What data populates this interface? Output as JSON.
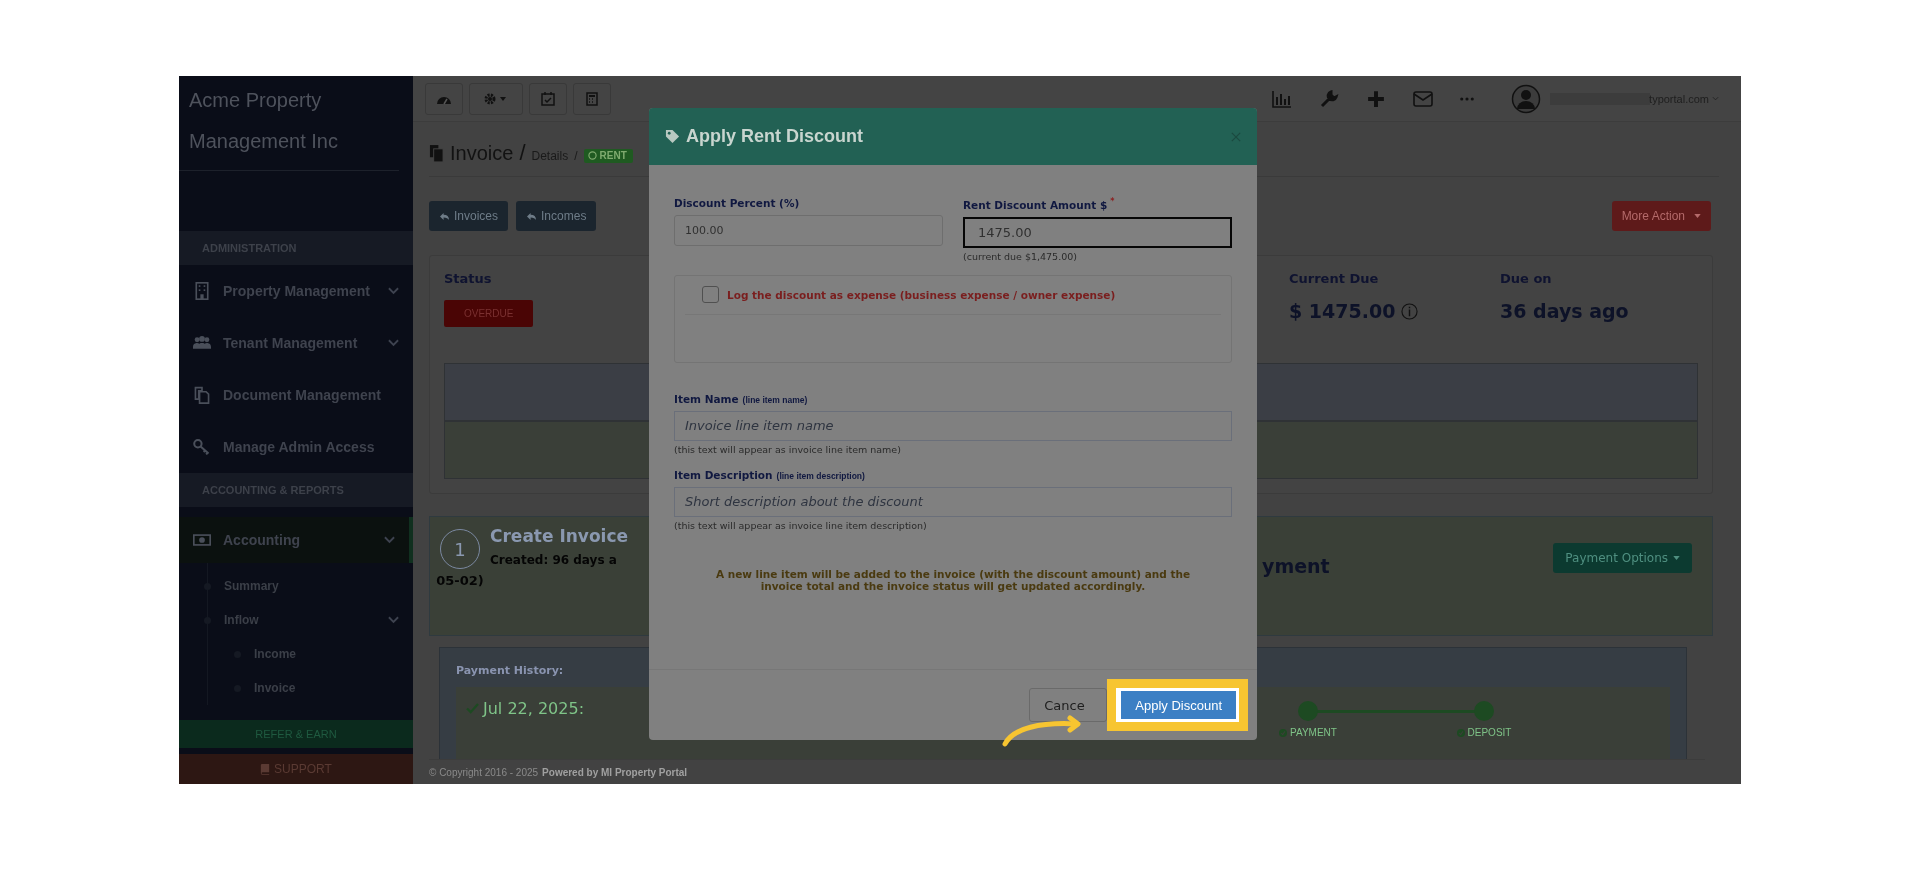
{
  "sidebar": {
    "brand": "Acme Property Management Inc",
    "sections": [
      {
        "title": "ADMINISTRATION",
        "items": [
          {
            "label": "Property Management",
            "has_submenu": true,
            "selected": false
          },
          {
            "label": "Tenant Management",
            "has_submenu": true,
            "selected": false
          },
          {
            "label": "Document Management",
            "has_submenu": false,
            "selected": false
          },
          {
            "label": "Manage Admin Access",
            "has_submenu": false,
            "selected": false
          }
        ]
      },
      {
        "title": "ACCOUNTING & REPORTS",
        "items": [
          {
            "label": "Accounting",
            "has_submenu": true,
            "selected": true,
            "children": [
              {
                "label": "Summary",
                "has_submenu": false
              },
              {
                "label": "Inflow",
                "has_submenu": true,
                "children": [
                  {
                    "label": "Income"
                  },
                  {
                    "label": "Invoice"
                  }
                ]
              }
            ]
          }
        ]
      }
    ],
    "refer_button": "REFER & EARN",
    "support_button": "SUPPORT"
  },
  "topbar": {
    "user": "typortal.com"
  },
  "header": {
    "title": "Invoice",
    "separator": "/",
    "crumb": "Details",
    "crumb_separator": "/",
    "badge": "RENT"
  },
  "actions": [
    {
      "label": "Invoices",
      "kind": "back"
    },
    {
      "label": "Incomes",
      "kind": "back"
    },
    {
      "label": "More Action",
      "kind": "dropdown"
    }
  ],
  "summary": [
    {
      "label": "Status",
      "value": "OVERDUE",
      "kind": "badge"
    },
    {
      "label": "Current Due",
      "value": "$ 1475.00",
      "kind": "amount"
    },
    {
      "label": "Due on",
      "value": "36 days ago",
      "kind": "text"
    }
  ],
  "step": {
    "number": "1",
    "title": "Create Invoice",
    "created": "Created: 96 days a",
    "date": "05-02)",
    "next_title": "yment",
    "button": "Payment Options"
  },
  "history": {
    "title": "Payment History:",
    "date": "Jul 22, 2025:",
    "stages": [
      {
        "label": "PAYMENT",
        "done": true
      },
      {
        "label": "DEPOSIT",
        "done": true
      }
    ]
  },
  "footer": {
    "copyright": "© Copyright 2016 - 2025",
    "powered": "Powered by MI Property Portal"
  },
  "modal": {
    "title": "Apply Rent Discount",
    "fields_row": [
      {
        "label": "Discount Percent (%)",
        "value": "100.00",
        "focused": false
      },
      {
        "label": "Rent Discount Amount $",
        "required_mark": "*",
        "value": "1475.00",
        "focused": true,
        "hint": "(current due $1,475.00)"
      }
    ],
    "expense_checkbox": {
      "label": "Log the discount as expense (business expense / owner expense)",
      "checked": false
    },
    "text_fields": [
      {
        "label": "Item Name",
        "sublabel": "(line item name)",
        "placeholder": "Invoice line item name",
        "hint": "(this text will appear as invoice line item name)"
      },
      {
        "label": "Item Description",
        "sublabel": "(line item description)",
        "placeholder": "Short description about the discount",
        "hint": "(this text will appear as invoice line item description)"
      }
    ],
    "note": "A new line item will be added to the invoice (with the discount amount) and the invoice total and the invoice status will get updated accordingly.",
    "cancel_button": "Cance",
    "submit_button": "Apply Discount",
    "submit_highlighted": true
  }
}
